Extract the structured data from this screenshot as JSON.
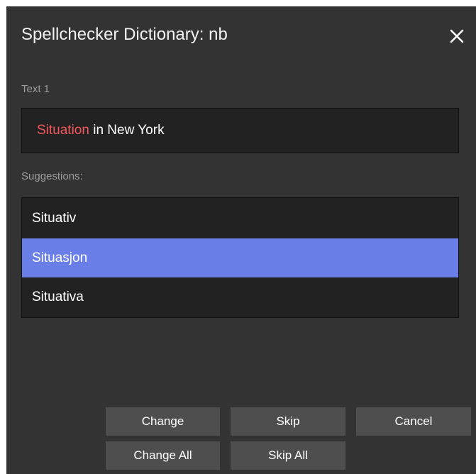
{
  "dialog": {
    "title": "Spellchecker Dictionary: nb",
    "close_icon": "close-icon"
  },
  "text_section": {
    "label": "Text 1",
    "misspelled_word": "Situation",
    "rest_of_text": " in New York",
    "misspelled_color": "#f0575a"
  },
  "suggestions": {
    "label": "Suggestions:",
    "items": [
      {
        "label": "Situativ",
        "selected": false
      },
      {
        "label": "Situasjon",
        "selected": true
      },
      {
        "label": "Situativa",
        "selected": false
      }
    ],
    "selected_color": "#6a7ee8"
  },
  "buttons": {
    "change": "Change",
    "skip": "Skip",
    "cancel": "Cancel",
    "change_all": "Change All",
    "skip_all": "Skip All"
  }
}
